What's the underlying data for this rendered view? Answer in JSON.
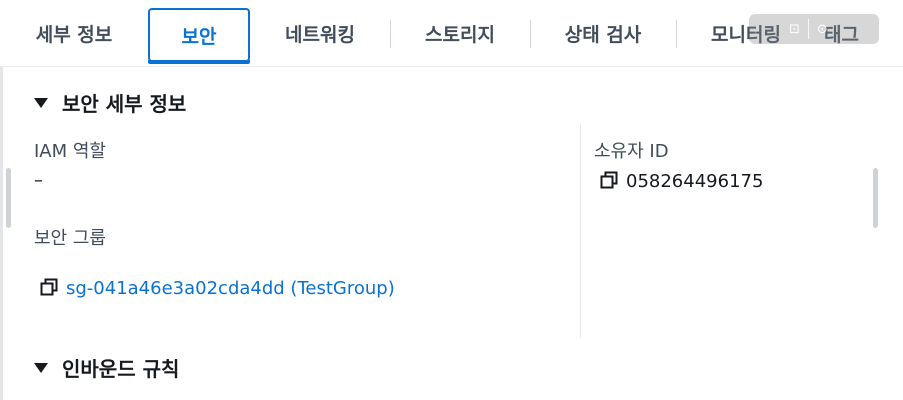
{
  "tabs": [
    {
      "label": "세부 정보",
      "active": false
    },
    {
      "label": "보안",
      "active": true
    },
    {
      "label": "네트워킹",
      "active": false
    },
    {
      "label": "스토리지",
      "active": false
    },
    {
      "label": "상태 검사",
      "active": false
    },
    {
      "label": "모니터링",
      "active": false
    },
    {
      "label": "태그",
      "active": false
    }
  ],
  "overlay": {
    "left_glyph": "⊡",
    "right_glyph": "⊙"
  },
  "security_details": {
    "header": "보안 세부 정보",
    "iam_role_label": "IAM 역할",
    "iam_role_value": "–",
    "owner_id_label": "소유자 ID",
    "owner_id_value": "058264496175",
    "security_groups_label": "보안 그룹",
    "security_group_link": "sg-041a46e3a02cda4dd (TestGroup)"
  },
  "inbound_rules": {
    "header": "인바운드 규칙"
  },
  "colors": {
    "accent": "#0972d3",
    "text": "#16191f",
    "label": "#414d5c",
    "divider": "#e9ebed"
  }
}
